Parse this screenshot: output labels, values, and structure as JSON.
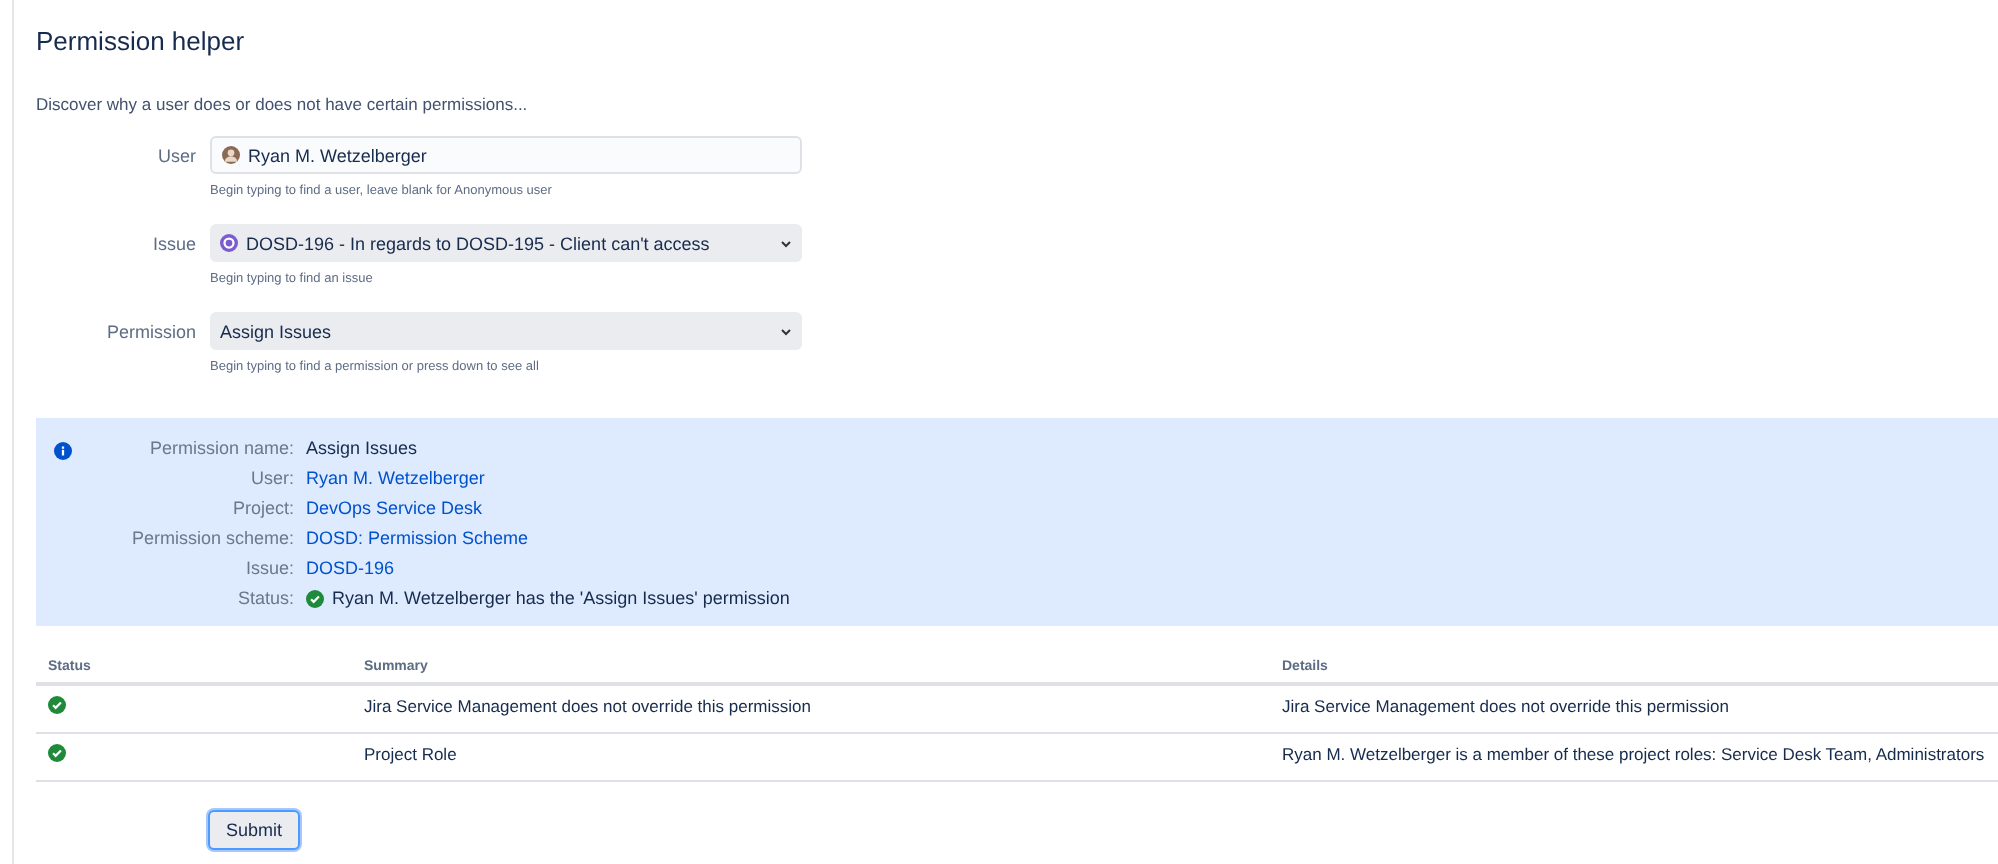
{
  "title": "Permission helper",
  "description": "Discover why a user does or does not have certain permissions...",
  "fields": [
    {
      "kind": "user",
      "label": "User",
      "value": "Ryan M. Wetzelberger",
      "hint": "Begin typing to find a user, leave blank for Anonymous user"
    },
    {
      "kind": "issue",
      "label": "Issue",
      "value": "DOSD-196 - In regards to DOSD-195 - Client can't access",
      "hint": "Begin typing to find an issue"
    },
    {
      "kind": "select",
      "label": "Permission",
      "value": "Assign Issues",
      "hint": "Begin typing to find a permission or press down to see all"
    }
  ],
  "info": {
    "rows": [
      {
        "kind": "text",
        "label": "Permission name:",
        "value": "Assign Issues"
      },
      {
        "kind": "link",
        "label": "User:",
        "value": "Ryan M. Wetzelberger"
      },
      {
        "kind": "link",
        "label": "Project:",
        "value": "DevOps Service Desk"
      },
      {
        "kind": "link",
        "label": "Permission scheme:",
        "value": "DOSD: Permission Scheme"
      },
      {
        "kind": "link",
        "label": "Issue:",
        "value": "DOSD-196"
      },
      {
        "kind": "status",
        "label": "Status:",
        "value": "Ryan M. Wetzelberger has the 'Assign Issues' permission"
      }
    ]
  },
  "table": {
    "columns": [
      "Status",
      "Summary",
      "Details"
    ],
    "rows": [
      {
        "passed": true,
        "summary": "Jira Service Management does not override this permission",
        "details": "Jira Service Management does not override this permission"
      },
      {
        "passed": true,
        "summary": "Project Role",
        "details": "Ryan M. Wetzelberger is a member of these project roles: Service Desk Team, Administrators"
      }
    ]
  },
  "submit": "Submit"
}
